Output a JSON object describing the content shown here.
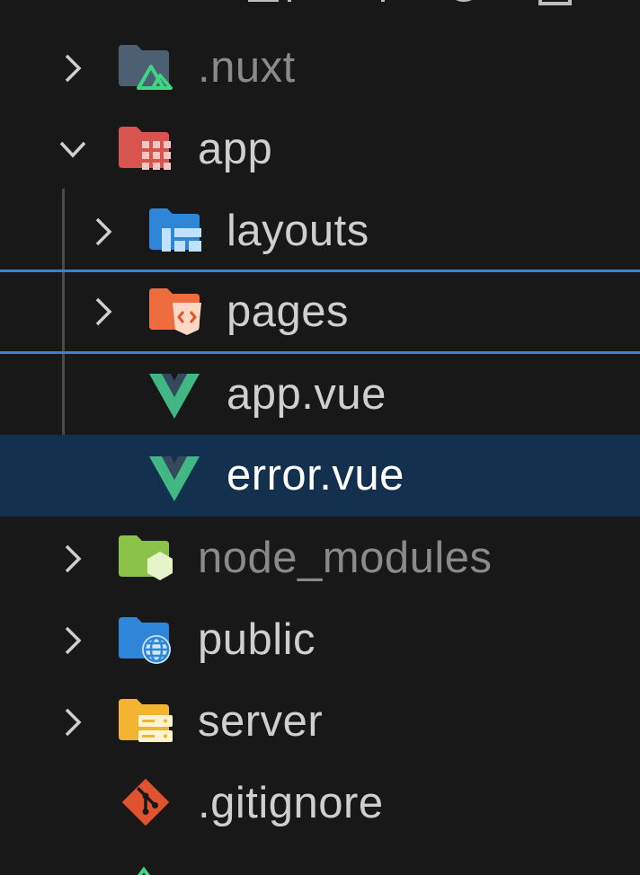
{
  "toolbar": {
    "icons": [
      "new-file-icon",
      "new-folder-icon",
      "refresh-icon",
      "collapse-all-icon"
    ]
  },
  "tree": {
    "items": [
      {
        "label": ".nuxt",
        "icon": "nuxt-folder-icon",
        "expanded": false,
        "dimmed": true
      },
      {
        "label": "app",
        "icon": "app-folder-icon",
        "expanded": true
      },
      {
        "label": "layouts",
        "icon": "layouts-folder-icon",
        "expanded": false
      },
      {
        "label": "pages",
        "icon": "pages-folder-icon",
        "expanded": false,
        "drop_target": true
      },
      {
        "label": "app.vue",
        "icon": "vue-file-icon"
      },
      {
        "label": "error.vue",
        "icon": "vue-file-icon",
        "selected": true
      },
      {
        "label": "node_modules",
        "icon": "node-folder-icon",
        "expanded": false,
        "dimmed": true
      },
      {
        "label": "public",
        "icon": "public-folder-icon",
        "expanded": false
      },
      {
        "label": "server",
        "icon": "server-folder-icon",
        "expanded": false
      },
      {
        "label": ".gitignore",
        "icon": "git-file-icon"
      }
    ]
  },
  "colors": {
    "background": "#181818",
    "selection": "#13304f",
    "drop_border": "#3b7fd6",
    "text": "#cfcfcf",
    "text_dim": "#8a8a8a",
    "vue_green": "#41b883",
    "vue_dark": "#35495e"
  }
}
